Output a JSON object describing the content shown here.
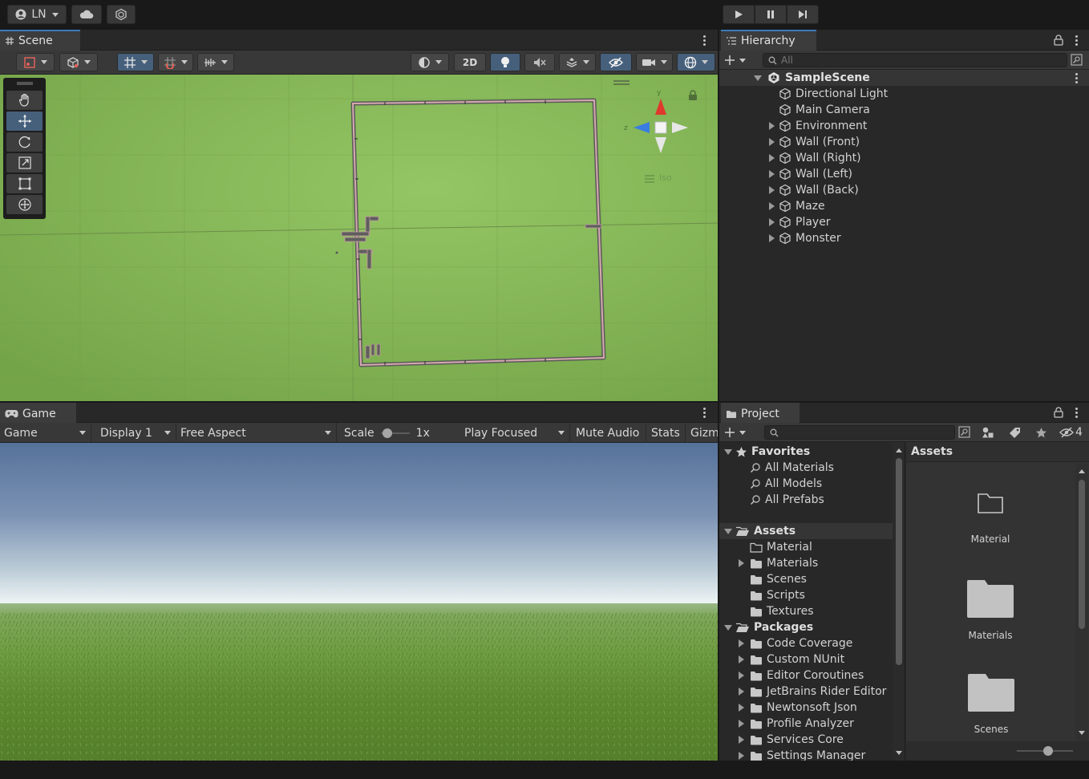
{
  "topbar": {
    "account_label": "LN"
  },
  "scene": {
    "tab_label": "Scene",
    "mode_2d_label": "2D",
    "gizmo_persp_label": "Iso"
  },
  "hierarchy": {
    "tab_label": "Hierarchy",
    "search_placeholder": "All",
    "scene_name": "SampleScene",
    "items": [
      {
        "label": "Directional Light",
        "expandable": false
      },
      {
        "label": "Main Camera",
        "expandable": false
      },
      {
        "label": "Environment",
        "expandable": true
      },
      {
        "label": "Wall (Front)",
        "expandable": true
      },
      {
        "label": "Wall (Right)",
        "expandable": true
      },
      {
        "label": "Wall (Left)",
        "expandable": true
      },
      {
        "label": "Wall (Back)",
        "expandable": true
      },
      {
        "label": "Maze",
        "expandable": true
      },
      {
        "label": "Player",
        "expandable": true
      },
      {
        "label": "Monster",
        "expandable": true
      }
    ]
  },
  "game": {
    "tab_label": "Game",
    "view_select": "Game",
    "display_select": "Display 1",
    "aspect_select": "Free Aspect",
    "scale_label": "Scale",
    "scale_value": "1x",
    "play_mode_select": "Play Focused",
    "mute_label": "Mute Audio",
    "stats_label": "Stats",
    "gizmos_label": "Gizmos"
  },
  "project": {
    "tab_label": "Project",
    "hidden_count": "4",
    "favorites_label": "Favorites",
    "favorites": [
      "All Materials",
      "All Models",
      "All Prefabs"
    ],
    "assets_label": "Assets",
    "assets_folders": [
      {
        "label": "Material",
        "expandable": false,
        "empty": true
      },
      {
        "label": "Materials",
        "expandable": true,
        "empty": false
      },
      {
        "label": "Scenes",
        "expandable": false,
        "empty": false
      },
      {
        "label": "Scripts",
        "expandable": false,
        "empty": false
      },
      {
        "label": "Textures",
        "expandable": false,
        "empty": false
      }
    ],
    "packages_label": "Packages",
    "packages": [
      "Code Coverage",
      "Custom NUnit",
      "Editor Coroutines",
      "JetBrains Rider Editor",
      "Newtonsoft Json",
      "Profile Analyzer",
      "Services Core",
      "Settings Manager"
    ],
    "grid_header": "Assets",
    "grid_items": [
      "Material",
      "Materials",
      "Scenes"
    ]
  },
  "colors": {
    "accent": "#3a79bb",
    "scene_ground": "#80b054",
    "gizmo_y": "#e0382d",
    "gizmo_z": "#3a7de0"
  }
}
